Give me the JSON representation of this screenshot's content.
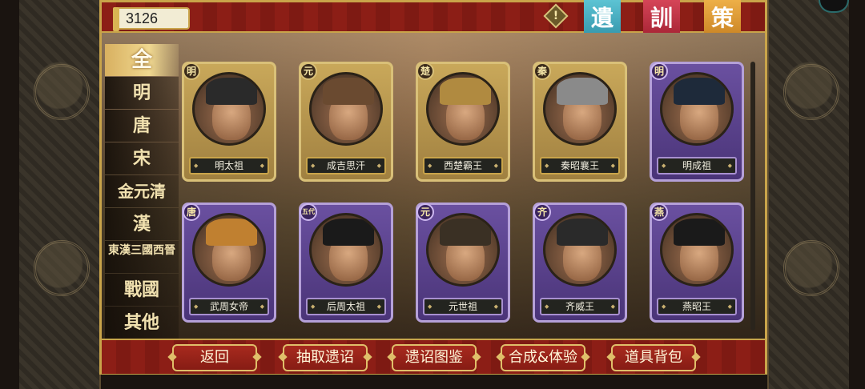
{
  "currency": {
    "amount": "3126"
  },
  "header": {
    "warn_glyph": "!",
    "banners": [
      "遺",
      "訓",
      "策"
    ]
  },
  "categories": [
    {
      "label": "全",
      "active": true
    },
    {
      "label": "明"
    },
    {
      "label": "唐"
    },
    {
      "label": "宋"
    },
    {
      "label": "金元清"
    },
    {
      "label": "漢"
    },
    {
      "label": "東漢三國西晉"
    },
    {
      "label": "戰國"
    },
    {
      "label": "其他"
    }
  ],
  "cards": [
    {
      "name": "明太祖",
      "dynasty": "明",
      "frame": "gold"
    },
    {
      "name": "成吉思汗",
      "dynasty": "元",
      "frame": "gold"
    },
    {
      "name": "西楚霸王",
      "dynasty": "楚",
      "frame": "gold"
    },
    {
      "name": "秦昭襄王",
      "dynasty": "秦",
      "frame": "gold"
    },
    {
      "name": "明成祖",
      "dynasty": "明",
      "frame": "purple"
    },
    {
      "name": "武周女帝",
      "dynasty": "唐",
      "frame": "purple"
    },
    {
      "name": "后周太祖",
      "dynasty": "五代",
      "frame": "purple"
    },
    {
      "name": "元世祖",
      "dynasty": "元",
      "frame": "purple"
    },
    {
      "name": "齐威王",
      "dynasty": "齐",
      "frame": "purple"
    },
    {
      "name": "燕昭王",
      "dynasty": "燕",
      "frame": "purple"
    }
  ],
  "buttons": [
    "返回",
    "抽取遗诏",
    "遗诏图鉴",
    "合成&体验",
    "道具背包"
  ],
  "colors": {
    "frame_red": "#7a1a14",
    "gold": "#c9a44a",
    "purple_card": "#4a3478"
  }
}
